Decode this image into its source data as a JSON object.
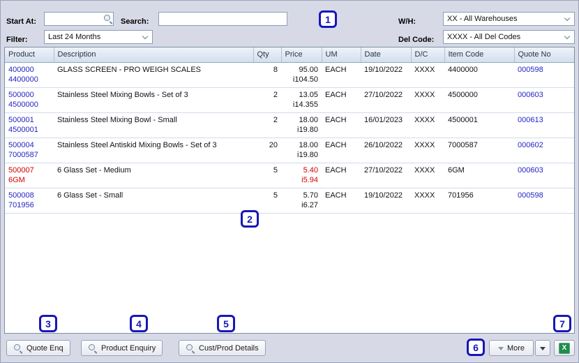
{
  "colors": {
    "annotation_blue": "#1717b8",
    "link_blue": "#2424c4",
    "alert_red": "#d40000",
    "excel_green": "#1f8b4d"
  },
  "filters": {
    "start_at": {
      "label": "Start At:",
      "value": ""
    },
    "search": {
      "label": "Search:",
      "value": ""
    },
    "filter": {
      "label": "Filter:",
      "value": "Last 24 Months"
    },
    "warehouse": {
      "label": "W/H:",
      "value": "XX - All Warehouses"
    },
    "del_code": {
      "label": "Del Code:",
      "value": "XXXX - All Del Codes"
    }
  },
  "table": {
    "columns": [
      "Product",
      "Description",
      "Qty",
      "Price",
      "UM",
      "Date",
      "D/C",
      "Item Code",
      "Quote No"
    ],
    "rows": [
      {
        "product_top": "400000",
        "product_bottom": "4400000",
        "description": "GLASS SCREEN - PRO WEIGH SCALES",
        "qty": "8",
        "price_top": "95.00",
        "price_bottom": "i104.50",
        "um": "EACH",
        "date": "19/10/2022",
        "dc": "XXXX",
        "item_code": "4400000",
        "quote_no": "000598",
        "red": false
      },
      {
        "product_top": "500000",
        "product_bottom": "4500000",
        "description": "Stainless Steel Mixing Bowls - Set of 3",
        "qty": "2",
        "price_top": "13.05",
        "price_bottom": "i14.355",
        "um": "EACH",
        "date": "27/10/2022",
        "dc": "XXXX",
        "item_code": "4500000",
        "quote_no": "000603",
        "red": false
      },
      {
        "product_top": "500001",
        "product_bottom": "4500001",
        "description": "Stainless Steel Mixing Bowl - Small",
        "qty": "2",
        "price_top": "18.00",
        "price_bottom": "i19.80",
        "um": "EACH",
        "date": "16/01/2023",
        "dc": "XXXX",
        "item_code": "4500001",
        "quote_no": "000613",
        "red": false
      },
      {
        "product_top": "500004",
        "product_bottom": "7000587",
        "description": "Stainless Steel Antiskid Mixing Bowls - Set of 3",
        "qty": "20",
        "price_top": "18.00",
        "price_bottom": "i19.80",
        "um": "EACH",
        "date": "26/10/2022",
        "dc": "XXXX",
        "item_code": "7000587",
        "quote_no": "000602",
        "red": false
      },
      {
        "product_top": "500007",
        "product_bottom": "6GM",
        "description": "6 Glass Set - Medium",
        "qty": "5",
        "price_top": "5.40",
        "price_bottom": "i5.94",
        "um": "EACH",
        "date": "27/10/2022",
        "dc": "XXXX",
        "item_code": "6GM",
        "quote_no": "000603",
        "red": true
      },
      {
        "product_top": "500008",
        "product_bottom": "701956",
        "description": "6 Glass Set - Small",
        "qty": "5",
        "price_top": "5.70",
        "price_bottom": "i6.27",
        "um": "EACH",
        "date": "19/10/2022",
        "dc": "XXXX",
        "item_code": "701956",
        "quote_no": "000598",
        "red": false
      }
    ]
  },
  "toolbar": {
    "quote_enq": "Quote Enq",
    "product_enquiry": "Product Enquiry",
    "cust_prod_details": "Cust/Prod Details",
    "more": "More",
    "excel_glyph": "X"
  },
  "annotations": [
    "1",
    "2",
    "3",
    "4",
    "5",
    "6",
    "7"
  ]
}
